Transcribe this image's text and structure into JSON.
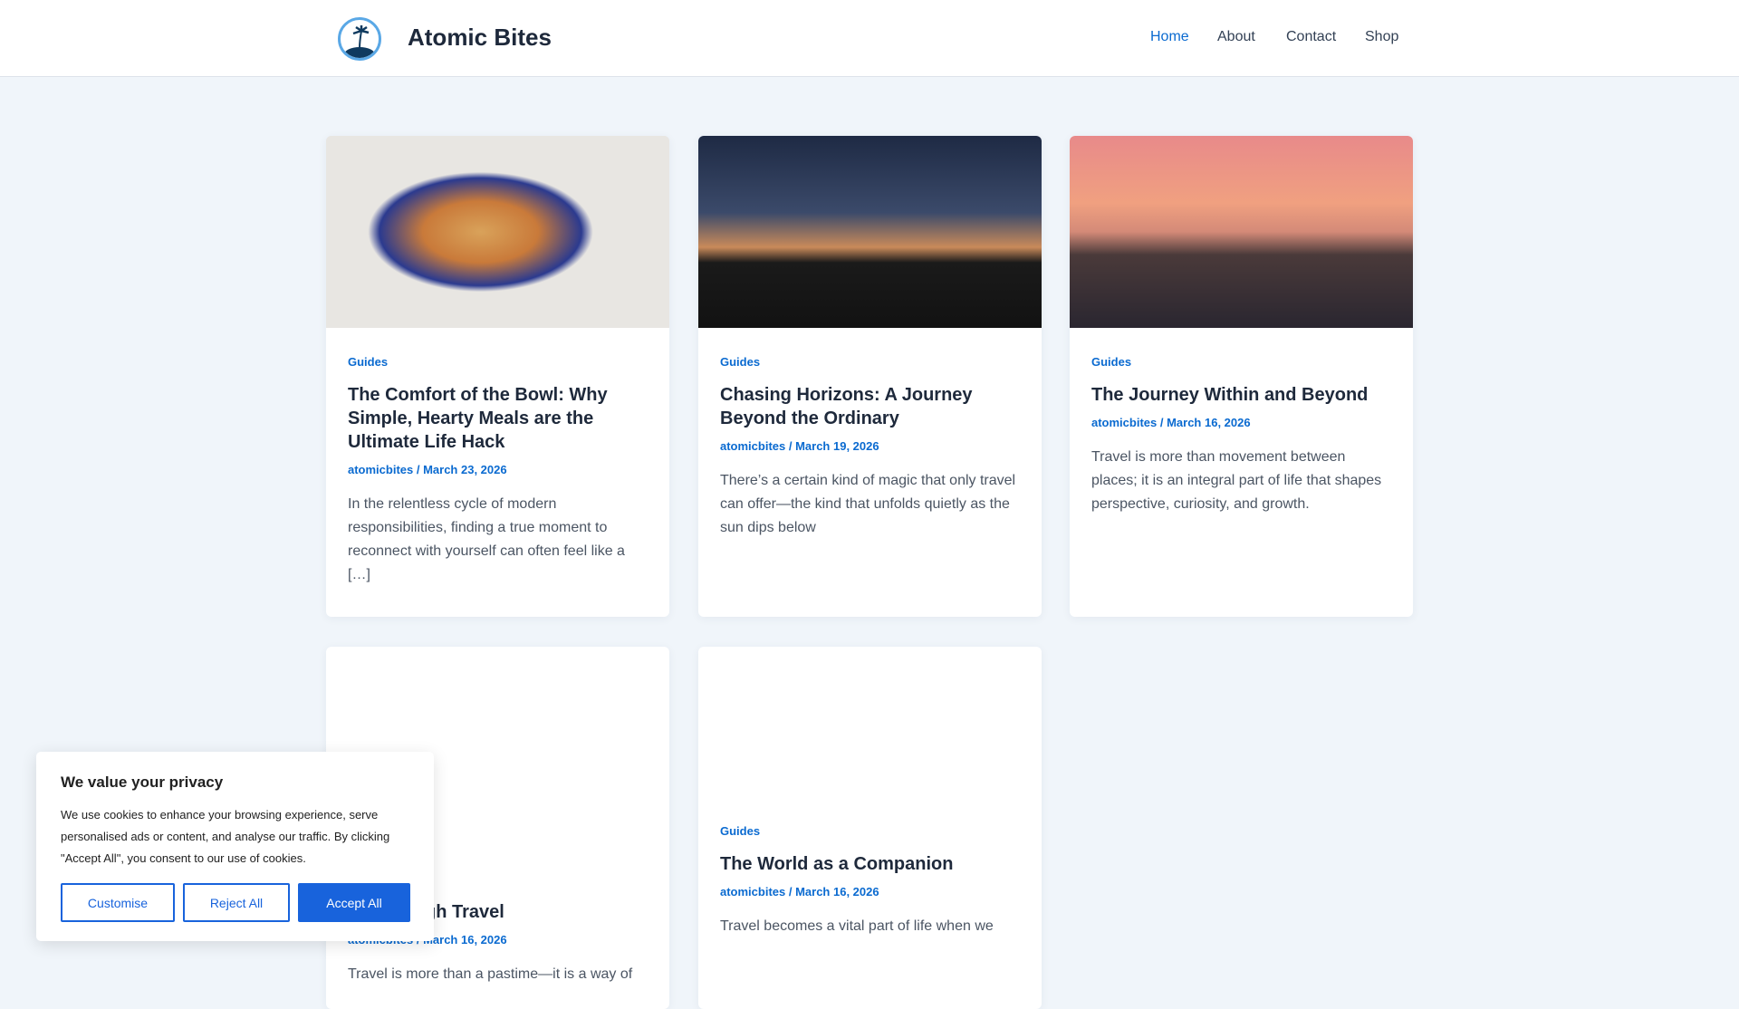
{
  "header": {
    "site_title": "Atomic Bites",
    "nav": [
      "Home",
      "About",
      "Contact",
      "Shop"
    ],
    "active": "Home"
  },
  "posts": [
    {
      "category": "Guides",
      "title": "The Comfort of the Bowl: Why Simple, Hearty Meals are the Ultimate Life Hack",
      "meta": "atomicbites / March 23, 2026",
      "excerpt": "In the relentless cycle of modern responsibilities, finding a true moment to reconnect with yourself can often feel like a […]"
    },
    {
      "category": "Guides",
      "title": "Chasing Horizons: A Journey Beyond the Ordinary",
      "meta": "atomicbites / March 19, 2026",
      "excerpt": "There’s a certain kind of magic that only travel can offer—the kind that unfolds quietly as the sun dips below"
    },
    {
      "category": "Guides",
      "title": "The Journey Within and Beyond",
      "meta": "atomicbites / March 16, 2026",
      "excerpt": "Travel is more than movement between places; it is an integral part of life that shapes perspective, curiosity, and growth."
    },
    {
      "title": "gh Travel",
      "meta": "atomicbites / March 16, 2026",
      "excerpt": "Travel is more than a pastime—it is a way of"
    },
    {
      "category": "Guides",
      "title": "The World as a Companion",
      "meta": "atomicbites / March 16, 2026",
      "excerpt": "Travel becomes a vital part of life when we"
    }
  ],
  "cookie": {
    "title": "We value your privacy",
    "body": "We use cookies to enhance your browsing experience, serve personalised ads or content, and analyse our traffic. By clicking \"Accept All\", you consent to our use of cookies.",
    "customise": "Customise",
    "reject": "Reject All",
    "accept": "Accept All"
  },
  "colors": {
    "accent": "#0a6ad0",
    "cookie_button": "#1863dc"
  }
}
